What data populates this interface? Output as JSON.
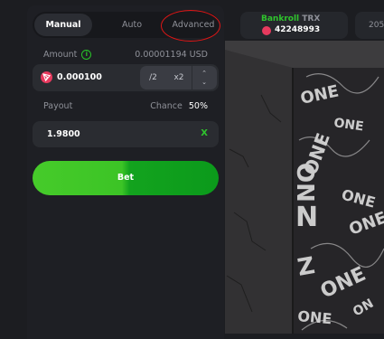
{
  "tabs": {
    "manual": "Manual",
    "auto": "Auto",
    "advanced": "Advanced"
  },
  "amount": {
    "label": "Amount",
    "usd_value": "0.00001194 USD",
    "value": "0.000100",
    "half_label": "/2",
    "double_label": "x2"
  },
  "payout": {
    "label": "Payout",
    "chance_label": "Chance",
    "chance_value": "50%",
    "value": "1.9800",
    "clear_label": "X"
  },
  "bet_label": "Bet",
  "header": {
    "bankroll_label": "Bankroll",
    "bankroll_currency": "TRX",
    "bankroll_value": "42248993",
    "next_pill_text": "205"
  },
  "colors": {
    "accent_green": "#2fc42d",
    "trx_red": "#e63a5e",
    "annotation_ring": "#e01515"
  }
}
